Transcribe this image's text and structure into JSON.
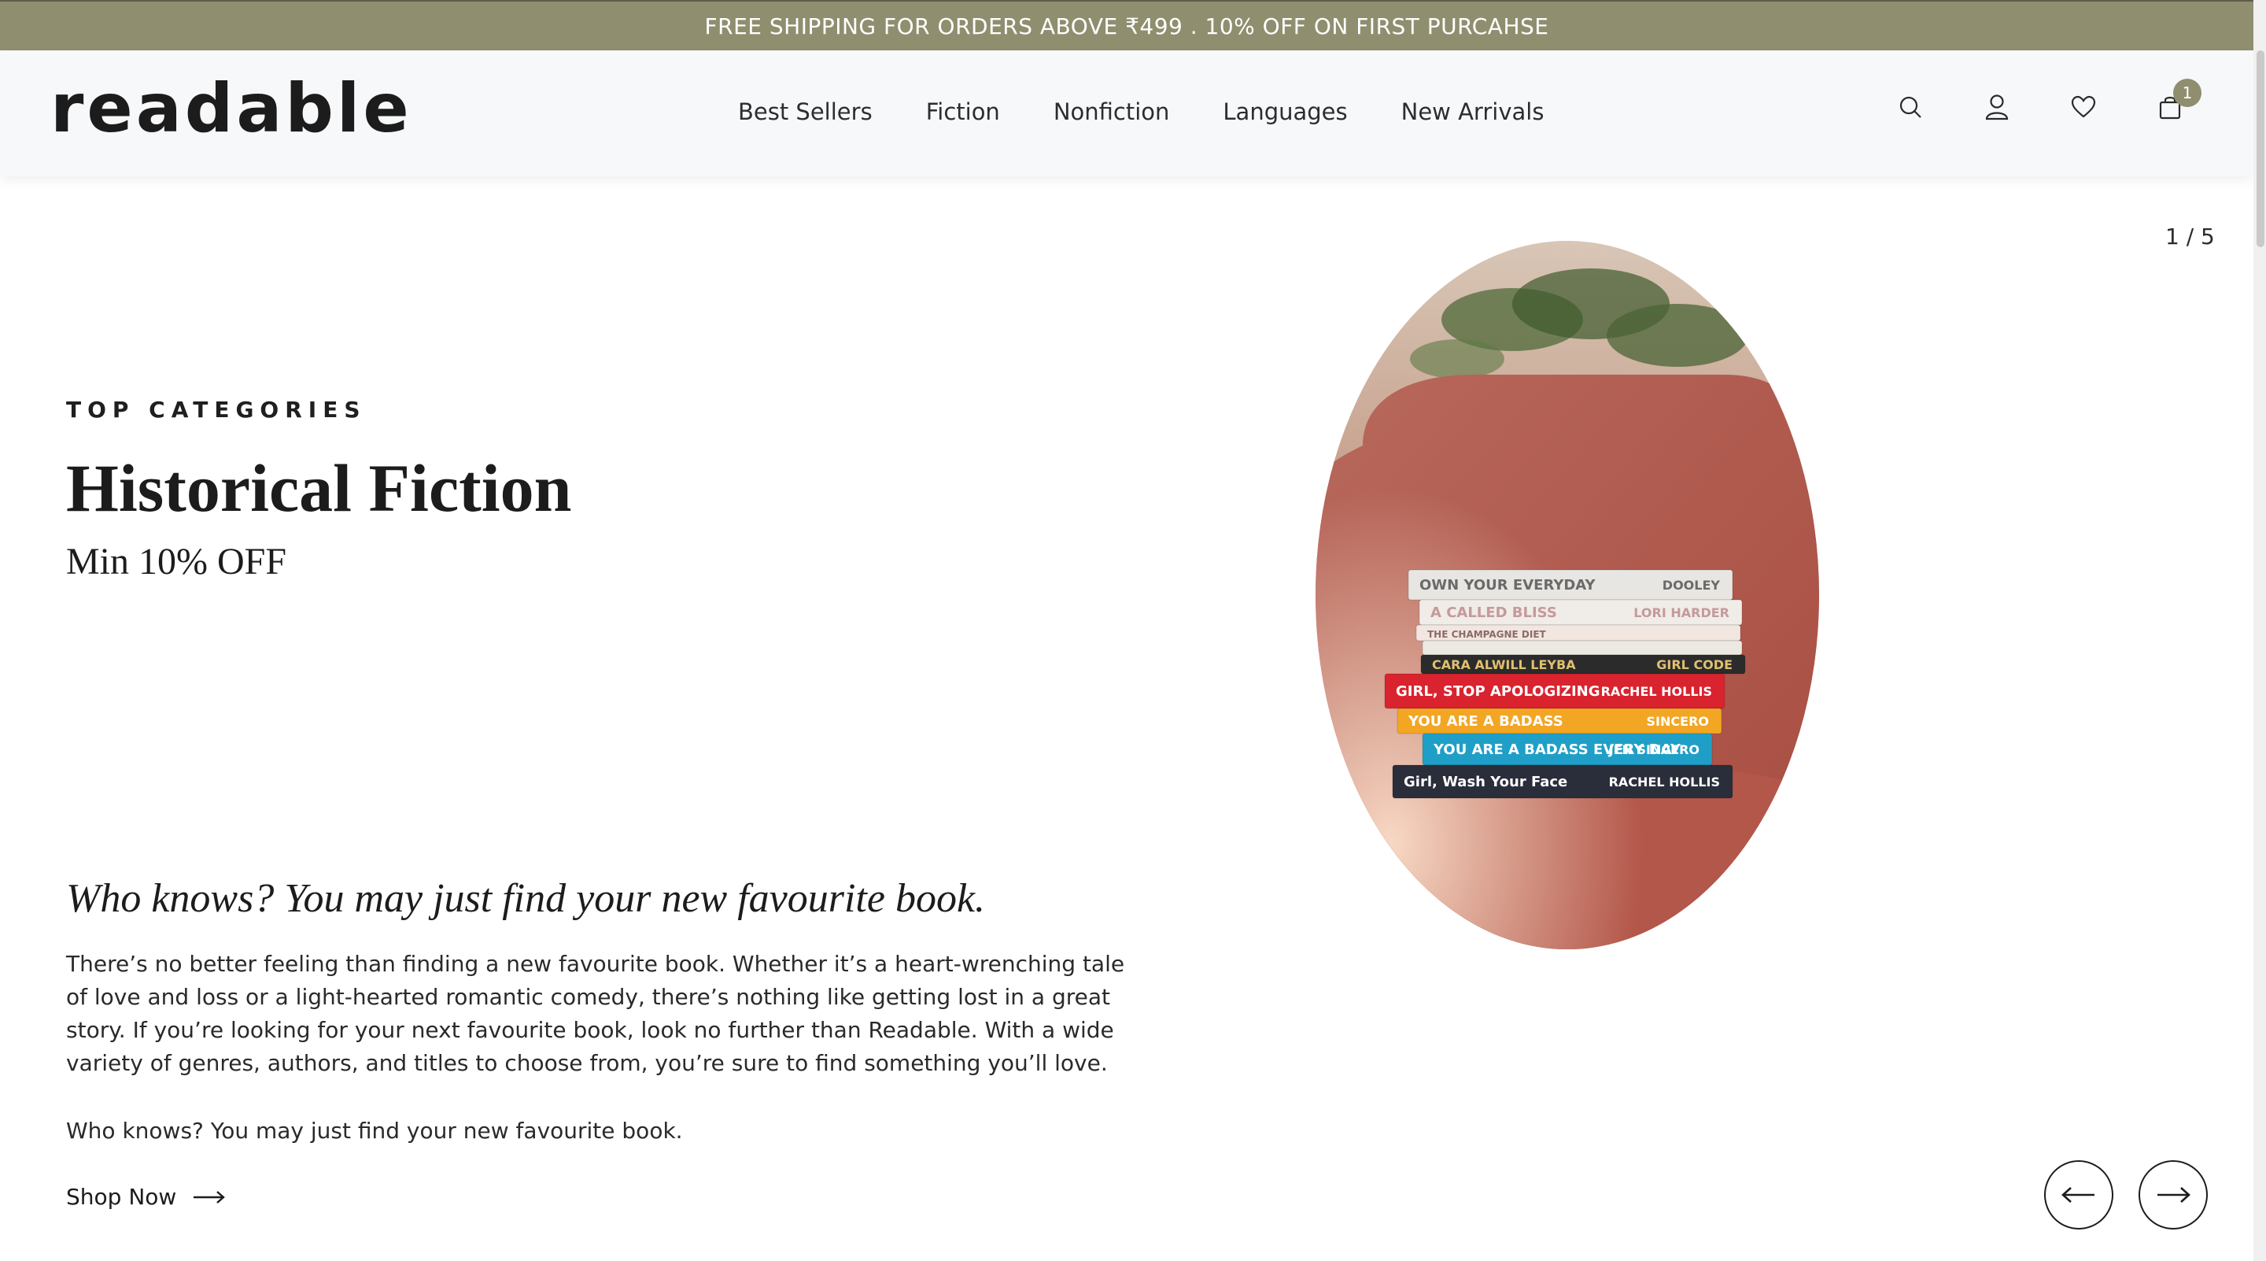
{
  "announcement": {
    "text": "FREE SHIPPING FOR ORDERS ABOVE ₹499 . 10% OFF ON FIRST PURCAHSE"
  },
  "header": {
    "logo": "readable",
    "nav": [
      {
        "label": "Best Sellers"
      },
      {
        "label": "Fiction"
      },
      {
        "label": "Nonfiction"
      },
      {
        "label": "Languages"
      },
      {
        "label": "New Arrivals"
      }
    ],
    "icons": [
      "search-icon",
      "account-icon",
      "wishlist-icon",
      "cart-icon"
    ],
    "cart_count": "1"
  },
  "slider": {
    "counter": "1 / 5"
  },
  "hero": {
    "eyebrow": "TOP CATEGORIES",
    "title": "Historical Fiction",
    "subtitle": "Min 10% OFF",
    "tagline": "Who knows? You may just find your new favourite book.",
    "paragraph": "There’s no better feeling than finding a new favourite book. Whether it’s a heart-wrenching tale of love and loss or a light-hearted romantic comedy, there’s nothing like getting lost in a great story. If you’re looking for your next favourite book, look no further than Readable. With a wide variety of genres, authors, and titles to choose from, you’re sure to find something you’ll love.",
    "paragraph2": "Who knows? You may just find your new favourite book.",
    "cta": "Shop Now"
  },
  "books": [
    {
      "title": "OWN YOUR EVERYDAY",
      "author": "DOOLEY",
      "color": "#e8e6e2",
      "text": "#6a6a6a"
    },
    {
      "title": "A CALLED BLISS",
      "author": "LORI HARDER",
      "color": "#f0ece8",
      "text": "#c49a9a"
    },
    {
      "title": "THE CHAMPAGNE DIET",
      "author": "",
      "color": "#f2e6e0",
      "text": "#8c6a6a"
    },
    {
      "title": "",
      "author": "",
      "color": "#ece8e2",
      "text": "#7a7a7a"
    },
    {
      "title": "CARA ALWILL LEYBA",
      "author": "GIRL CODE",
      "color": "#2b2b2b",
      "text": "#e0c070"
    },
    {
      "title": "GIRL, STOP APOLOGIZING",
      "author": "RACHEL HOLLIS",
      "color": "#d9232e",
      "text": "#ffffff"
    },
    {
      "title": "YOU ARE A BADASS",
      "author": "SINCERO",
      "color": "#f2a623",
      "text": "#ffffff"
    },
    {
      "title": "YOU ARE A BADASS EVERY DAY",
      "author": "JEN SINCERO",
      "color": "#1f9fc7",
      "text": "#ffffff"
    },
    {
      "title": "Girl, Wash Your Face",
      "author": "RACHEL HOLLIS",
      "color": "#2a2d3a",
      "text": "#ffffff"
    }
  ],
  "colors": {
    "accent": "#8f8e6f",
    "text": "#1c1c1c",
    "chair": "#b8594e"
  }
}
